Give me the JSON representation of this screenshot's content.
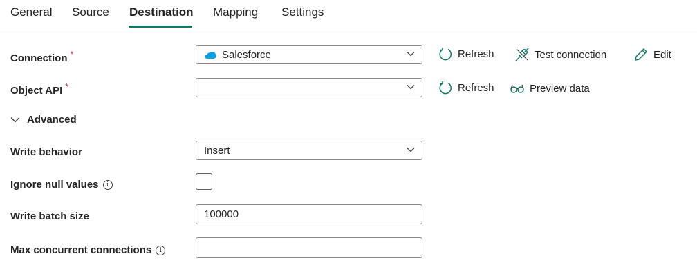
{
  "tabs": [
    {
      "label": "General"
    },
    {
      "label": "Source"
    },
    {
      "label": "Destination"
    },
    {
      "label": "Mapping"
    },
    {
      "label": "Settings"
    }
  ],
  "active_tab": "Destination",
  "accent_color": "#117865",
  "required_color": "#c4314b",
  "connection": {
    "label": "Connection",
    "required_marker": "*",
    "value": "Salesforce",
    "icon": "salesforce-cloud-icon",
    "actions": {
      "refresh": "Refresh",
      "test": "Test connection",
      "edit": "Edit"
    }
  },
  "object_api": {
    "label": "Object API",
    "required_marker": "*",
    "value": "",
    "actions": {
      "refresh": "Refresh",
      "preview": "Preview data"
    }
  },
  "advanced": {
    "label": "Advanced",
    "expanded": true
  },
  "write_behavior": {
    "label": "Write behavior",
    "value": "Insert"
  },
  "ignore_null": {
    "label": "Ignore null values",
    "info_icon": "i",
    "checked": false
  },
  "write_batch_size": {
    "label": "Write batch size",
    "value": "100000"
  },
  "max_concurrent": {
    "label": "Max concurrent connections",
    "info_icon": "i",
    "value": ""
  }
}
